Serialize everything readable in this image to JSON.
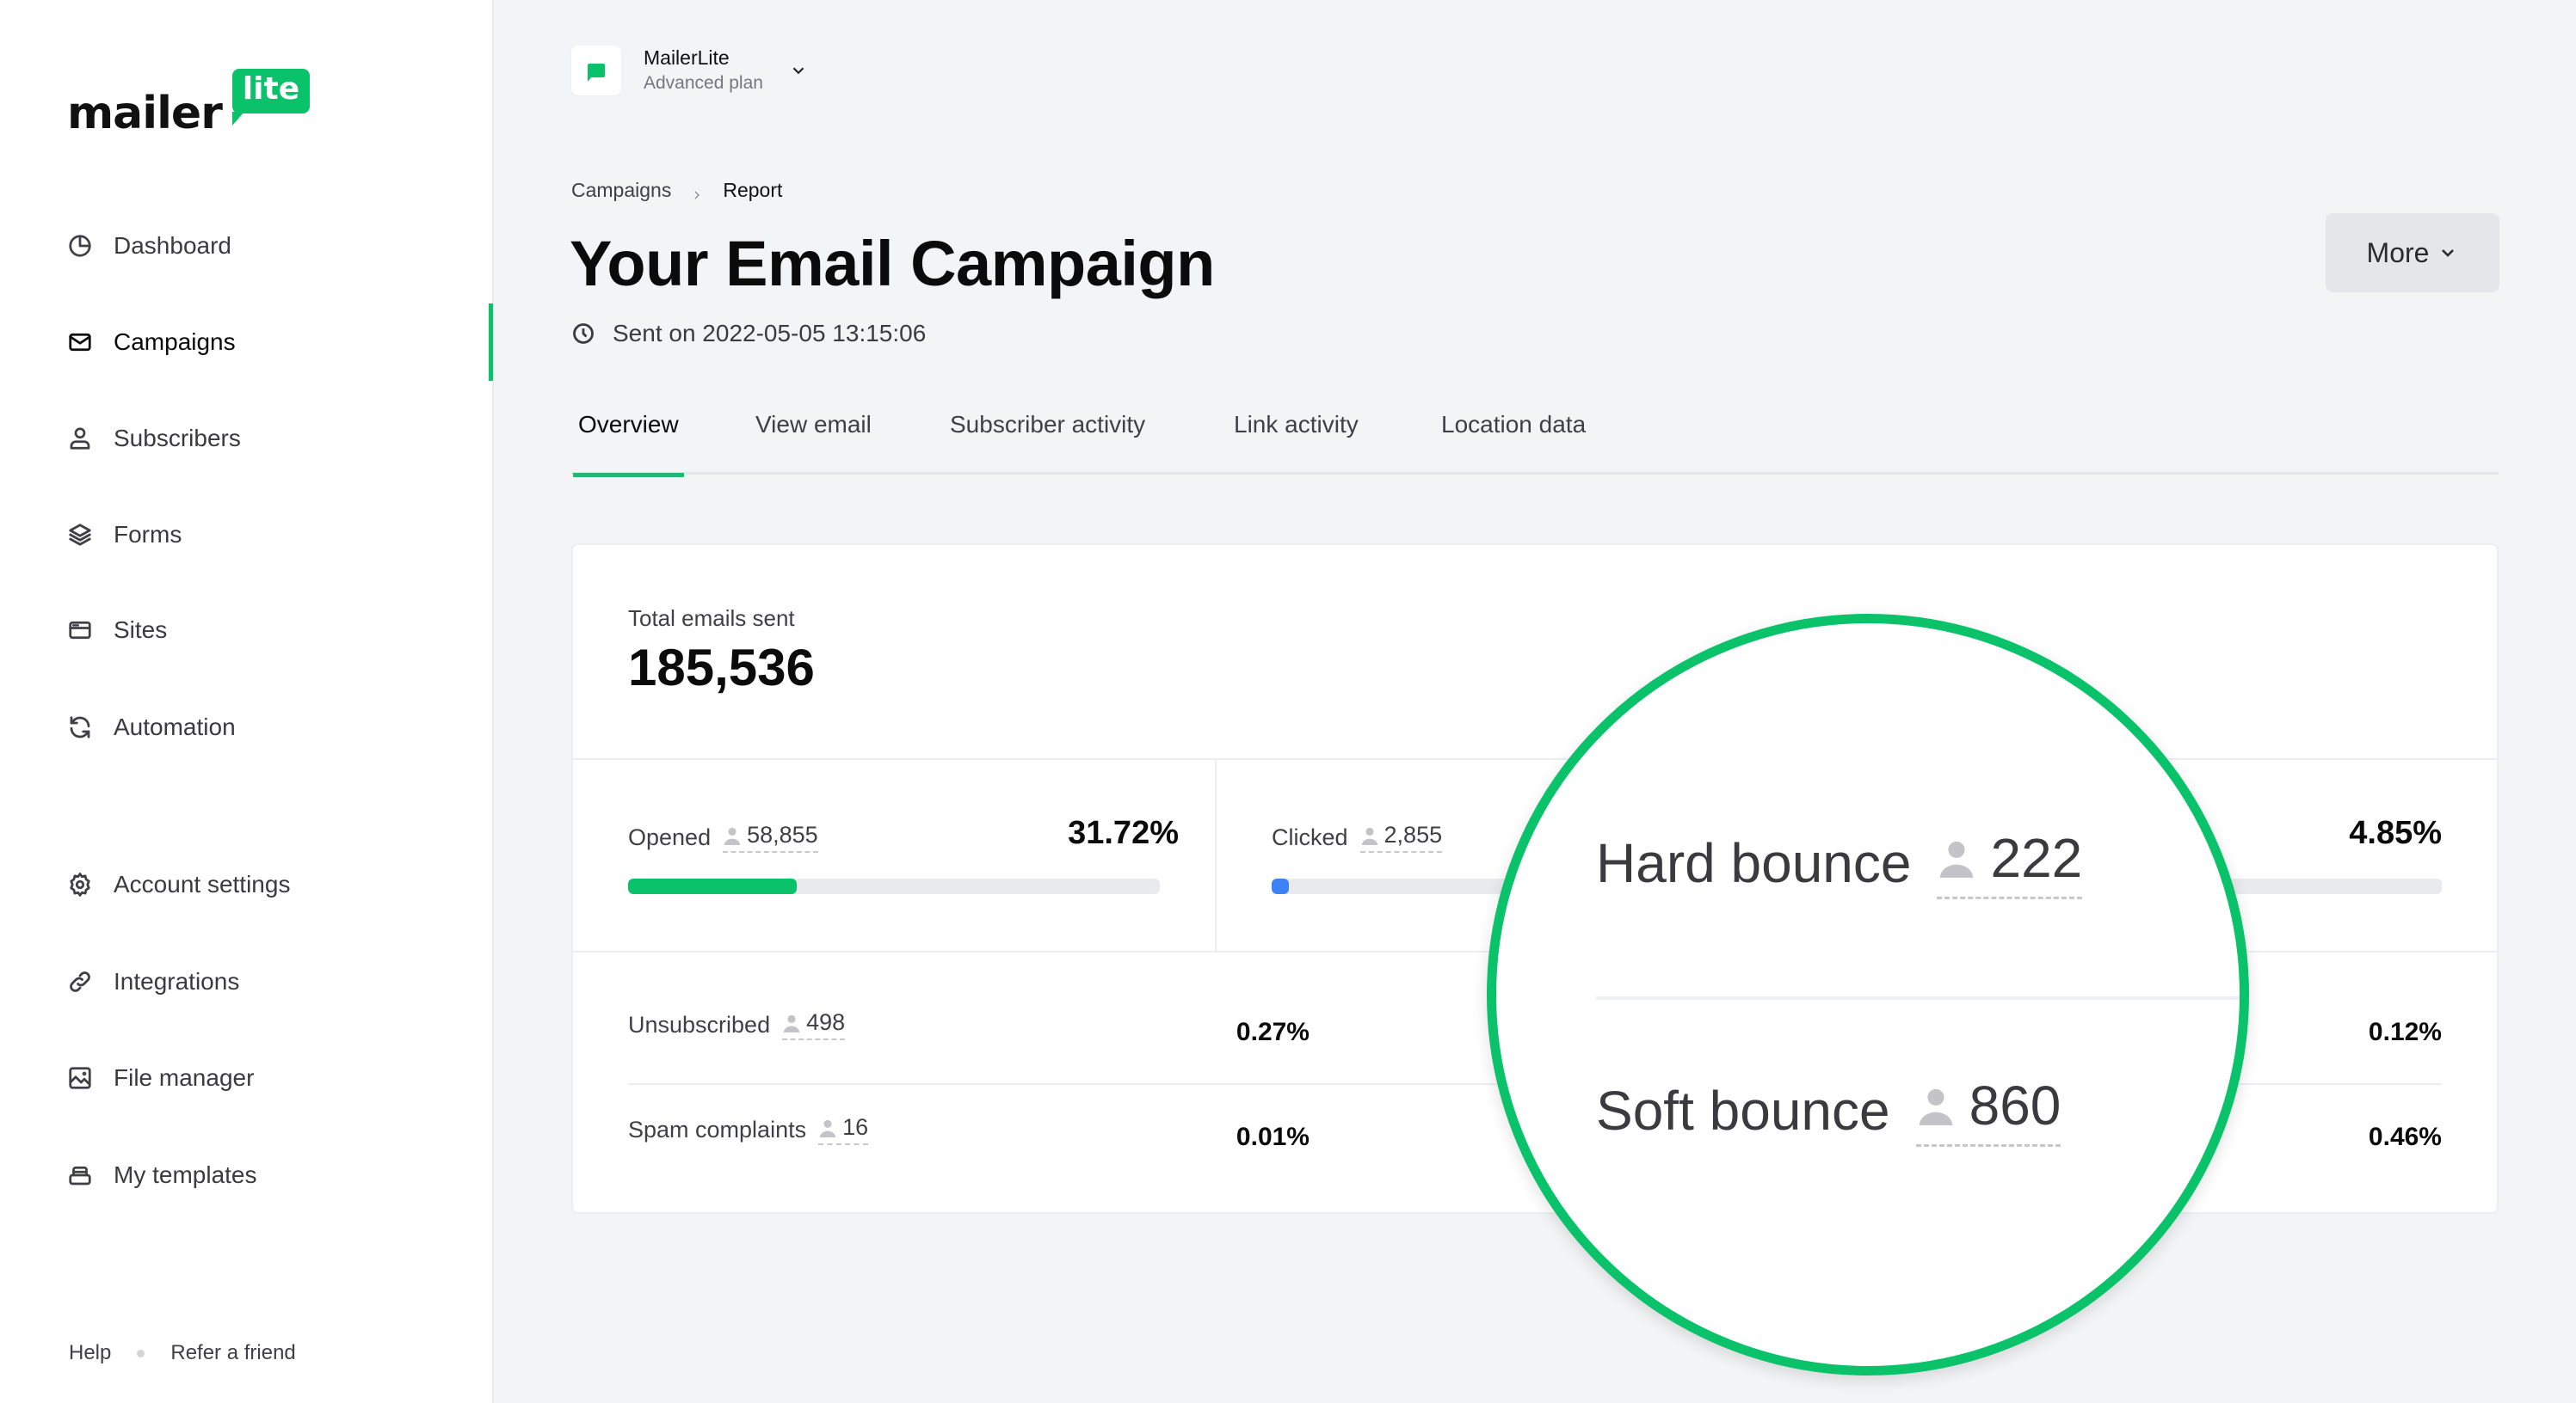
{
  "brand": {
    "word": "mailer",
    "badge": "lite",
    "accent": "#09c269"
  },
  "sidebar": {
    "items": [
      {
        "label": "Dashboard",
        "icon": "pie-chart-icon",
        "active": false
      },
      {
        "label": "Campaigns",
        "icon": "envelope-icon",
        "active": true
      },
      {
        "label": "Subscribers",
        "icon": "user-icon",
        "active": false
      },
      {
        "label": "Forms",
        "icon": "layers-icon",
        "active": false
      },
      {
        "label": "Sites",
        "icon": "browser-window-icon",
        "active": false
      },
      {
        "label": "Automation",
        "icon": "refresh-icon",
        "active": false
      }
    ],
    "secondary_items": [
      {
        "label": "Account settings",
        "icon": "gear-icon"
      },
      {
        "label": "Integrations",
        "icon": "link-icon"
      },
      {
        "label": "File manager",
        "icon": "image-icon"
      },
      {
        "label": "My templates",
        "icon": "templates-stack-icon"
      }
    ],
    "footer": {
      "help": "Help",
      "refer": "Refer a friend"
    }
  },
  "account": {
    "name": "MailerLite",
    "plan": "Advanced plan"
  },
  "breadcrumb": {
    "parent": "Campaigns",
    "current": "Report"
  },
  "page": {
    "title": "Your Email Campaign",
    "sent_on": "Sent on 2022-05-05 13:15:06",
    "more_label": "More"
  },
  "tabs": [
    {
      "label": "Overview",
      "active": true
    },
    {
      "label": "View email",
      "active": false
    },
    {
      "label": "Subscriber activity",
      "active": false
    },
    {
      "label": "Link activity",
      "active": false
    },
    {
      "label": "Location data",
      "active": false
    }
  ],
  "report": {
    "total_label": "Total emails sent",
    "total_value": "185,536",
    "opened": {
      "label": "Opened",
      "count": "58,855",
      "percent": "31.72%",
      "progress": 31.72,
      "color": "#09c269"
    },
    "clicked": {
      "label": "Clicked",
      "count": "2,855",
      "progress": 1.5,
      "color": "#3b82f6"
    },
    "third_metric": {
      "percent": "4.85%"
    },
    "unsubscribed": {
      "label": "Unsubscribed",
      "count": "498",
      "percent": "0.27%"
    },
    "spam": {
      "label": "Spam complaints",
      "count": "16",
      "percent": "0.01%"
    },
    "hard_bounce": {
      "label": "Hard bounce",
      "count": "222",
      "percent": "0.12%"
    },
    "soft_bounce": {
      "label": "Soft bounce",
      "count": "860",
      "percent": "0.46%"
    }
  }
}
